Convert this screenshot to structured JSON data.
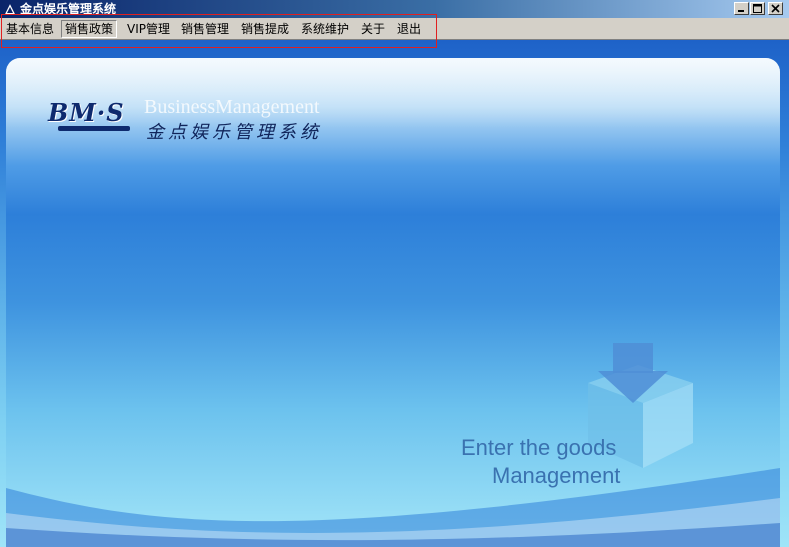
{
  "window": {
    "title": "金点娱乐管理系统",
    "title_icon": "triangle-app-icon",
    "controls": {
      "minimize_icon": "minimize-icon",
      "maximize_icon": "maximize-icon",
      "close_icon": "close-icon"
    }
  },
  "menu": {
    "items": [
      {
        "label": "基本信息"
      },
      {
        "label": "销售政策",
        "active": true
      },
      {
        "label": "VIP管理"
      },
      {
        "label": "销售管理"
      },
      {
        "label": "销售提成"
      },
      {
        "label": "系统维护"
      },
      {
        "label": "关于"
      },
      {
        "label": "退出"
      }
    ]
  },
  "banner": {
    "logo_text": "BM·S",
    "brand_en": "BusinessManagement",
    "brand_cn": "金点娱乐管理系统",
    "tagline_line1": "Enter the goods",
    "tagline_line2": "Management"
  },
  "colors": {
    "highlight_box": "#e02020",
    "titlebar_start": "#0a246a",
    "titlebar_end": "#a6caf0"
  }
}
